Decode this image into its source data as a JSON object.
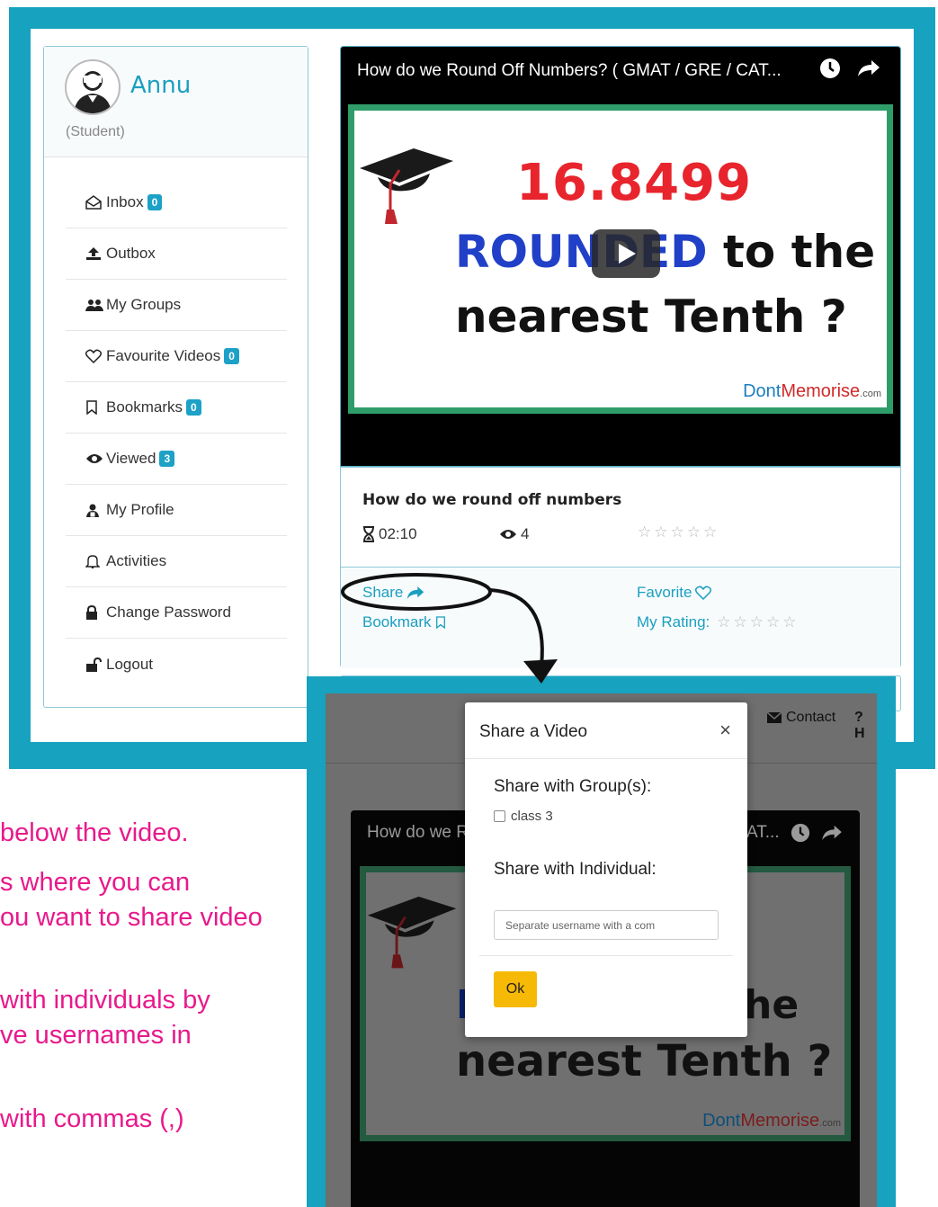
{
  "user": {
    "name": "Annu",
    "role": "(Student)"
  },
  "sidebar": {
    "items": [
      {
        "icon": "envelope-open-icon",
        "label": "Inbox",
        "badge": "0"
      },
      {
        "icon": "upload-icon",
        "label": "Outbox",
        "badge": ""
      },
      {
        "icon": "users-icon",
        "label": "My Groups",
        "badge": ""
      },
      {
        "icon": "heart-icon",
        "label": "Favourite Videos",
        "badge": "0"
      },
      {
        "icon": "bookmark-icon",
        "label": "Bookmarks",
        "badge": "0"
      },
      {
        "icon": "eye-icon",
        "label": "Viewed",
        "badge": "3"
      },
      {
        "icon": "user-secret-icon",
        "label": "My Profile",
        "badge": ""
      },
      {
        "icon": "bell-icon",
        "label": "Activities",
        "badge": ""
      },
      {
        "icon": "lock-icon",
        "label": "Change Password",
        "badge": ""
      },
      {
        "icon": "unlock-icon",
        "label": "Logout",
        "badge": ""
      }
    ]
  },
  "video": {
    "title_bar": "How do we Round Off Numbers? ( GMAT / GRE / CAT...",
    "thumb_number": "16.8499",
    "thumb_line2_blue": "ROUNDED",
    "thumb_line2_dark": " to the",
    "thumb_line3": "nearest Tenth ?",
    "brand_1": "Dont",
    "brand_2": "Memorise",
    "brand_3": ".com"
  },
  "info": {
    "title": "How do we round off numbers",
    "duration": "02:10",
    "views": "4",
    "rating_stars": 5,
    "share_label": "Share",
    "bookmark_label": "Bookmark",
    "favorite_label": "Favorite",
    "my_rating_label": "My Rating:"
  },
  "background_page": {
    "contact": "Contact",
    "help": "? H",
    "video_title_left": "How do we R",
    "video_title_right": "AT...",
    "thumb_he": "he",
    "thumb_R": "R",
    "thumb_line3": "nearest Tenth ?",
    "brand_1": "Dont",
    "brand_2": "Memorise",
    "brand_3": ".com"
  },
  "modal": {
    "title": "Share a Video",
    "close": "×",
    "group_label": "Share with Group(s):",
    "group_option": "class 3",
    "individual_label": "Share with Individual:",
    "input_placeholder": "Separate username with a com",
    "ok_label": "Ok"
  },
  "notes": [
    "below the video.",
    "s where you can",
    "ou want to share video",
    "with individuals by",
    "ve usernames in",
    "with commas (,)"
  ],
  "colors": {
    "frame": "#17a2bf",
    "accent": "#1a9fc0",
    "note": "#e8198b",
    "ok_button": "#f6b905"
  }
}
